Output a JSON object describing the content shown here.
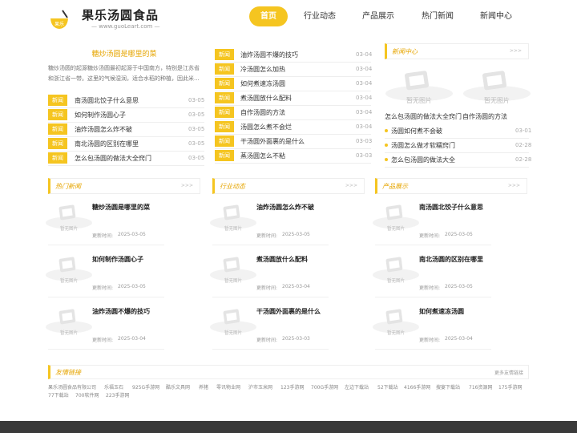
{
  "brand": {
    "title": "果乐汤圆食品",
    "sub": "— www.guoLeart.com —",
    "badge": "果乐"
  },
  "nav": [
    "首页",
    "行业动态",
    "产品展示",
    "热门新闻",
    "新闻中心"
  ],
  "featured": {
    "title": "糖炒汤圆是哪里的菜",
    "desc": "糖炒汤圆的起源糖炒汤圆最初起源于中国南方，特别是江苏省和浙江省一带。这里的气候湿润，适合水稻的种植，因此米..."
  },
  "tag_label": "新闻",
  "left_list": [
    {
      "t": "南汤圆北饺子什么意思",
      "d": "03-05"
    },
    {
      "t": "如何制作汤圆心子",
      "d": "03-05"
    },
    {
      "t": "油炸汤圆怎么炸不破",
      "d": "03-05"
    },
    {
      "t": "南北汤圆的区别在哪里",
      "d": "03-05"
    },
    {
      "t": "怎么包汤圆的做法大全窍门",
      "d": "03-05"
    }
  ],
  "mid_list": [
    {
      "t": "油炸汤圆不爆的技巧",
      "d": "03-04"
    },
    {
      "t": "冷汤圆怎么加热",
      "d": "03-04"
    },
    {
      "t": "如何煮速冻汤圆",
      "d": "03-04"
    },
    {
      "t": "煮汤圆放什么配料",
      "d": "03-04"
    },
    {
      "t": "自作汤圆的方法",
      "d": "03-04"
    },
    {
      "t": "汤圆怎么煮不会烂",
      "d": "03-04"
    },
    {
      "t": "干汤圆外面裹的是什么",
      "d": "03-03"
    },
    {
      "t": "蒸汤圆怎么不粘",
      "d": "03-03"
    }
  ],
  "news_center": {
    "title": "新闻中心",
    "more": ">>>",
    "pics": [
      "怎么包汤圆的做法大全窍门",
      "自作汤圆的方法"
    ],
    "list": [
      {
        "t": "汤圆如何煮不会破",
        "d": "03-01"
      },
      {
        "t": "汤圆怎么做才软糯窍门",
        "d": "02-28"
      },
      {
        "t": "怎么包汤圆的做法大全",
        "d": "02-28"
      }
    ]
  },
  "placeholder_text": "暂无图片",
  "time_label": "更新时间:",
  "cols": [
    {
      "title": "热门新闻",
      "more": ">>>",
      "items": [
        {
          "t": "糖炒汤圆是哪里的菜",
          "d": "2025-03-05"
        },
        {
          "t": "如何制作汤圆心子",
          "d": "2025-03-05"
        },
        {
          "t": "油炸汤圆不爆的技巧",
          "d": "2025-03-04"
        }
      ]
    },
    {
      "title": "行业动态",
      "more": ">>>",
      "items": [
        {
          "t": "油炸汤圆怎么炸不破",
          "d": "2025-03-05"
        },
        {
          "t": "煮汤圆放什么配料",
          "d": "2025-03-04"
        },
        {
          "t": "干汤圆外面裹的是什么",
          "d": "2025-03-03"
        }
      ]
    },
    {
      "title": "产品展示",
      "more": ">>>",
      "items": [
        {
          "t": "南汤圆北饺子什么意思",
          "d": "2025-03-05"
        },
        {
          "t": "南北汤圆的区别在哪里",
          "d": "2025-03-05"
        },
        {
          "t": "如何煮速冻汤圆",
          "d": "2025-03-04"
        }
      ]
    }
  ],
  "friends": {
    "title": "友情链接",
    "more": "更多友情链接",
    "links": [
      "果乐汤圆食品有限公司",
      "乐福玉石",
      "925G手游网",
      "酷乐文具网",
      "养猪",
      "零讯物业网",
      "沪市玉米网",
      "123手游网",
      "700G手游网",
      "左边下载站",
      "52下载站",
      "4166手游网",
      "搜宴下载站",
      "716资源网",
      "175手游网",
      "77下载站",
      "700软件网",
      "223手游网"
    ]
  },
  "colors": {
    "accent": "#f5c520",
    "accent_text": "#e6a500",
    "footer": "#3a3a3a"
  }
}
